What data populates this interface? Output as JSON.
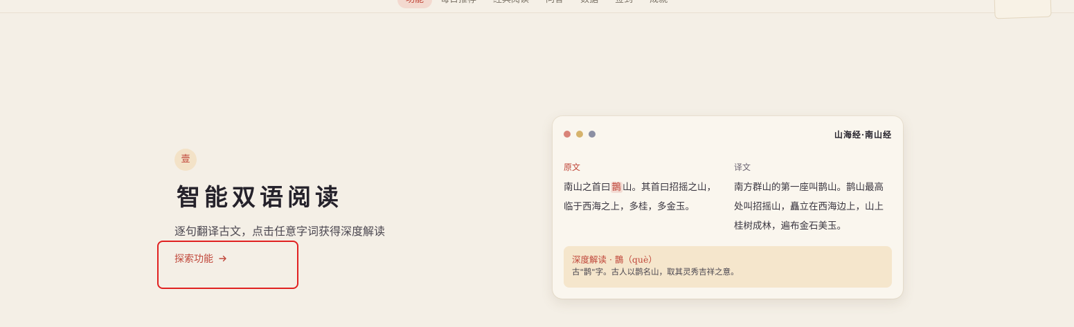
{
  "nav": {
    "items": [
      "功能",
      "每日推荐",
      "经典阅读",
      "问答",
      "数据",
      "签到",
      "成就"
    ],
    "active_index": 0
  },
  "feature": {
    "badge": "壹",
    "title": "智能双语阅读",
    "subtitle": "逐句翻译古文，点击任意字词获得深度解读",
    "explore_label": "探索功能",
    "explore_icon": "arrow-right-icon"
  },
  "card": {
    "title": "山海经·南山经",
    "original_label": "原文",
    "translation_label": "译文",
    "original_before": "南山之首曰",
    "original_highlight": "鵲",
    "original_after": "山。其首曰招摇之山，临于西海之上，多桂，多金玉。",
    "translation": "南方群山的第一座叫鹊山。鹊山最高处叫招摇山，矗立在西海边上，山上桂树成林，遍布金石美玉。",
    "note_head": "深度解读 · 鵲（què）",
    "note_body": "古\"鹊\"字。古人以鹊名山，取其灵秀吉祥之意。"
  },
  "colors": {
    "accent": "#c0473a",
    "background": "#f4efe6",
    "card": "#faf6ee",
    "note": "#f5e6cc"
  }
}
